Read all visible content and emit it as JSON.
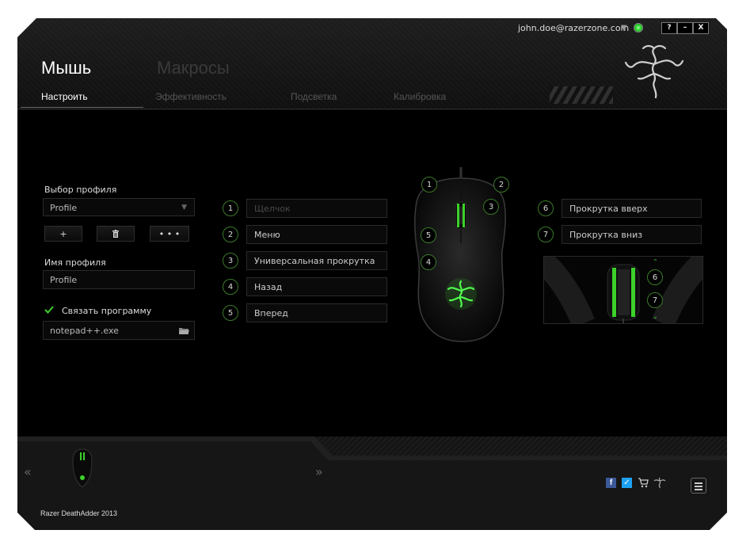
{
  "header": {
    "user_email": "john.doe@razerzone.com",
    "window_buttons": {
      "help": "?",
      "minimize": "–",
      "close": "X"
    },
    "main_tabs": [
      {
        "label": "Мышь",
        "active": true
      },
      {
        "label": "Макросы",
        "active": false
      }
    ],
    "sub_tabs": [
      {
        "label": "Настроить",
        "active": true
      },
      {
        "label": "Эффективность",
        "active": false
      },
      {
        "label": "Подсветка",
        "active": false
      },
      {
        "label": "Калибровка",
        "active": false
      }
    ]
  },
  "profile": {
    "select_label": "Выбор профиля",
    "selected": "Profile",
    "add_label": "+",
    "more_label": "• • •",
    "name_label": "Имя профиля",
    "name_value": "Profile",
    "link_label": "Связать программу",
    "link_checked": true,
    "program": "notepad++.exe"
  },
  "buttons_left": [
    {
      "num": "1",
      "label": "Щелчок",
      "disabled": true
    },
    {
      "num": "2",
      "label": "Меню",
      "disabled": false
    },
    {
      "num": "3",
      "label": "Универсальная прокрутка",
      "disabled": false
    },
    {
      "num": "4",
      "label": "Назад",
      "disabled": false
    },
    {
      "num": "5",
      "label": "Вперед",
      "disabled": false
    }
  ],
  "buttons_right": [
    {
      "num": "6",
      "label": "Прокрутка вверх"
    },
    {
      "num": "7",
      "label": "Прокрутка вниз"
    }
  ],
  "mouse_markers": [
    "1",
    "2",
    "3",
    "5",
    "4"
  ],
  "zoom_markers": [
    "6",
    "7"
  ],
  "footer": {
    "device_name": "Razer DeathAdder 2013",
    "prev_arrow": "«",
    "next_arrow": "»"
  },
  "colors": {
    "accent_green": "#3cd12a",
    "background": "#000000"
  }
}
